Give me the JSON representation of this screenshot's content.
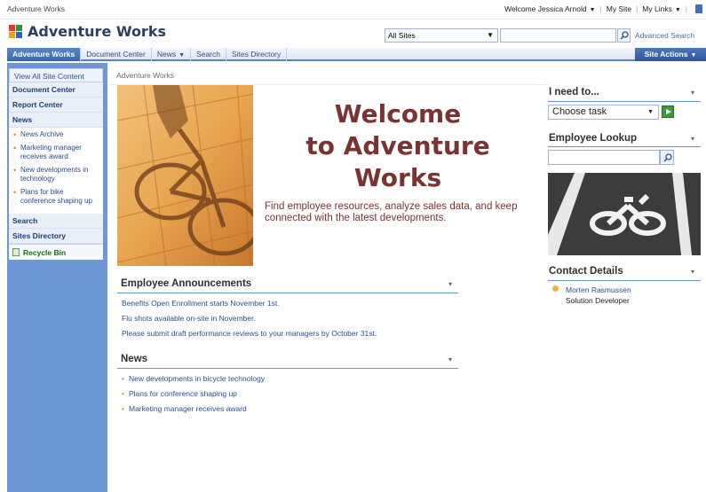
{
  "topbar": {
    "site_name": "Adventure Works",
    "welcome": "Welcome Jessica Arnold",
    "my_site": "My Site",
    "my_links": "My Links"
  },
  "header": {
    "title": "Adventure Works",
    "scope": "All Sites",
    "search_value": "",
    "advanced_search": "Advanced Search"
  },
  "nav": {
    "tabs": [
      {
        "label": "Adventure Works",
        "active": true
      },
      {
        "label": "Document Center"
      },
      {
        "label": "News"
      },
      {
        "label": "Search"
      },
      {
        "label": "Sites Directory"
      }
    ],
    "site_actions": "Site Actions"
  },
  "quick_launch": {
    "view_all": "View All Site Content",
    "document_center": "Document Center",
    "report_center": "Report Center",
    "news": "News",
    "news_items": [
      "News Archive",
      "Marketing manager receives award",
      "New developments in technology",
      "Plans for bike conference shaping up"
    ],
    "search": "Search",
    "sites_directory": "Sites Directory",
    "recycle_bin": "Recycle Bin"
  },
  "main": {
    "breadcrumb": "Adventure Works",
    "welcome_line1": "Welcome",
    "welcome_line2": "to Adventure",
    "welcome_line3": "Works",
    "welcome_sub": "Find employee resources, analyze sales data, and keep connected with the latest developments.",
    "announcements_title": "Employee Announcements",
    "announcements": [
      "Benefits Open Enrollment starts November 1st.",
      "Flu shots available on-site in November.",
      "Please submit draft performance reviews to your managers by October 31st."
    ],
    "news_title": "News",
    "news": [
      "New developments in bicycle technology",
      "Plans for conference shaping up",
      "Marketing manager receives award"
    ]
  },
  "right": {
    "ineed_title": "I need to...",
    "task_placeholder": "Choose task",
    "lookup_title": "Employee Lookup",
    "lookup_value": "",
    "contact_title": "Contact Details",
    "contact_name": "Morten Rasmussen",
    "contact_role": "Solution Developer"
  },
  "colors": {
    "accent": "#3b67ad",
    "welcome_text": "#7a3232",
    "link": "#2c4f8f",
    "quick_launch_bg": "#6e97d8"
  }
}
